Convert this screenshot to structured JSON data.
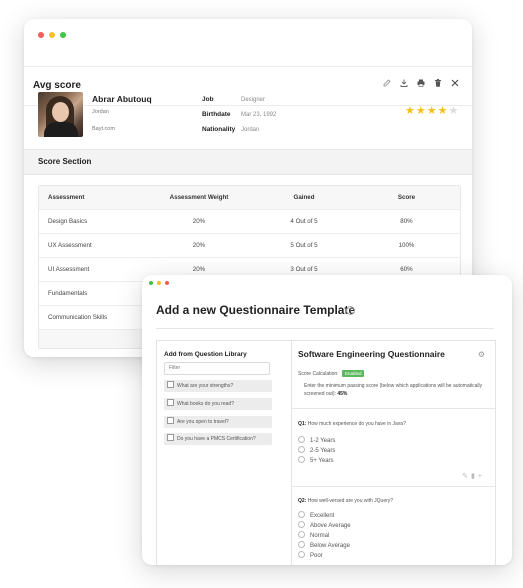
{
  "window_a": {
    "title": "Avg score",
    "actions": [
      "edit-icon",
      "download-icon",
      "print-icon",
      "trash-icon",
      "close-icon"
    ],
    "profile": {
      "name": "Abrar Abutouq",
      "location": "Jordan",
      "source": "Bayt.com",
      "fields": [
        {
          "label": "Job",
          "value": "Designer"
        },
        {
          "label": "Birthdate",
          "value": "Mar 23, 1992"
        },
        {
          "label": "Nationality",
          "value": "Jordan"
        }
      ],
      "rating": 4,
      "rating_max": 5
    },
    "section_title": "Score Section",
    "table": {
      "headers": [
        "Assessment",
        "Assessment Weight",
        "Gained",
        "Score"
      ],
      "rows": [
        [
          "Design Basics",
          "20%",
          "4 Out of 5",
          "80%"
        ],
        [
          "UX Assessment",
          "20%",
          "5 Out of 5",
          "100%"
        ],
        [
          "UI Assessment",
          "20%",
          "3 Out of 5",
          "60%"
        ],
        [
          "Fundamentals",
          "",
          "",
          ""
        ],
        [
          "Communication Skills",
          "",
          "",
          ""
        ]
      ]
    }
  },
  "window_b": {
    "title": "Add a new Questionnaire Template",
    "library": {
      "title": "Add from Question Library",
      "filter_placeholder": "Filter",
      "items": [
        "What are your strengths?",
        "What books do you read?",
        "Are you open to travel?",
        "Do you have a PMCS Certification?"
      ]
    },
    "questionnaire": {
      "title": "Software Engineering Questionnaire",
      "score_calc_label": "Score Calculation:",
      "score_calc_badge": "Enabled",
      "min_pass_text": "Enter the minimum passing score (below which applications will be automatically screened out):",
      "min_pass_value": "45%",
      "questions": [
        {
          "num": "Q1:",
          "text": "How much experience do you have in Java?",
          "options": [
            "1-2 Years",
            "2-5 Years",
            "5+ Years"
          ]
        },
        {
          "num": "Q2:",
          "text": "How well-versed are you with JQuery?",
          "options": [
            "Excellent",
            "Above Average",
            "Normal",
            "Below Average",
            "Poor"
          ]
        }
      ]
    },
    "colors": {
      "badge": "#5cb85c",
      "star": "#f5c018"
    }
  }
}
